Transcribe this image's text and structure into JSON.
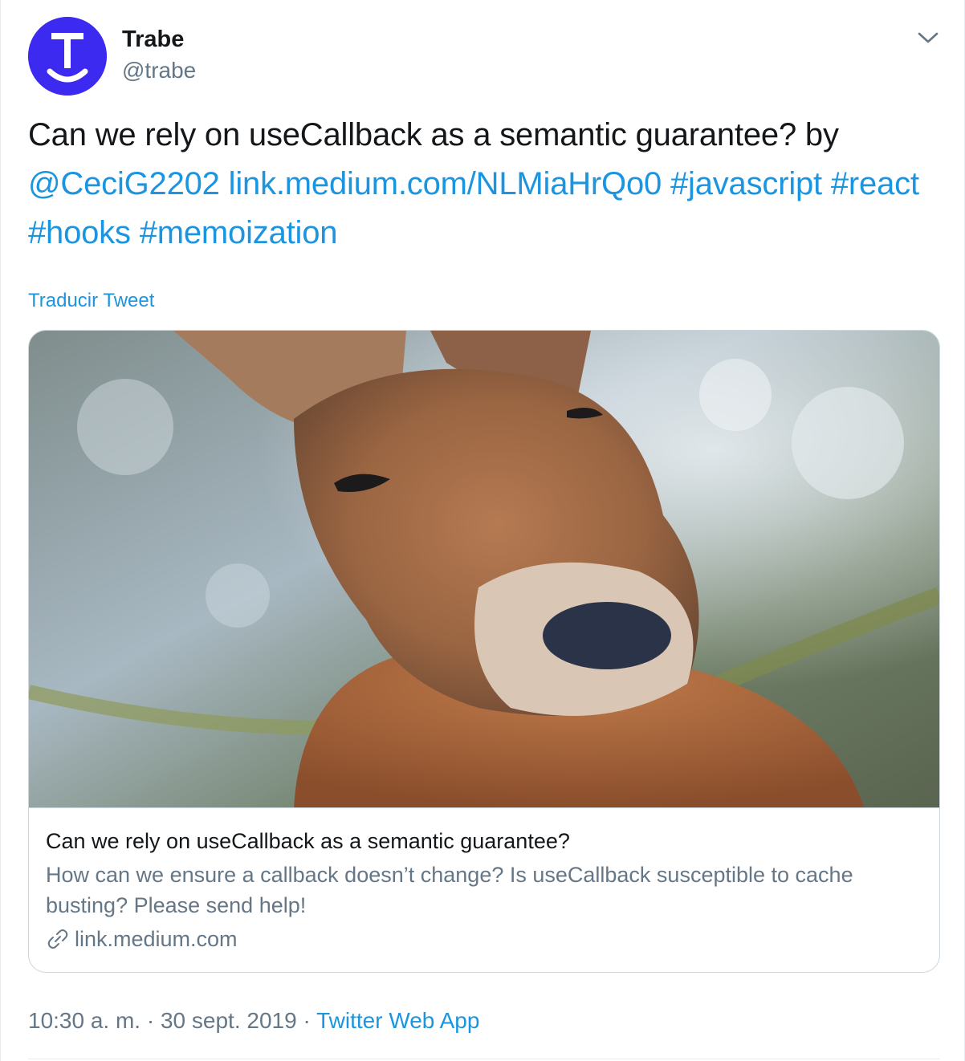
{
  "author": {
    "name": "Trabe",
    "handle": "@trabe",
    "avatar_letter": "T",
    "avatar_color": "#3d2af0"
  },
  "tweet": {
    "text_plain": "Can we rely on useCallback as a semantic guarantee? by",
    "mention": "@CeciG2202",
    "link": "link.medium.com/NLMiaHrQo0",
    "hashtags": [
      "#javascript",
      "#react",
      "#hooks",
      "#memoization"
    ],
    "translate_label": "Traducir Tweet"
  },
  "card": {
    "image_icon": "kangaroo-photo",
    "title": "Can we rely on useCallback as a semantic guarantee?",
    "description": "How can we ensure a callback doesn’t change? Is useCallback susceptible to cache busting? Please send help!",
    "domain": "link.medium.com",
    "link_icon": "link-icon"
  },
  "footer": {
    "time": "10:30 a. m.",
    "separator": "·",
    "date": "30 sept. 2019",
    "source": "Twitter Web App"
  },
  "colors": {
    "link": "#1b95e0",
    "text": "#14171a",
    "secondary": "#657786",
    "border": "#ccd6dd"
  },
  "icons": {
    "caret": "chevron-down-icon"
  }
}
